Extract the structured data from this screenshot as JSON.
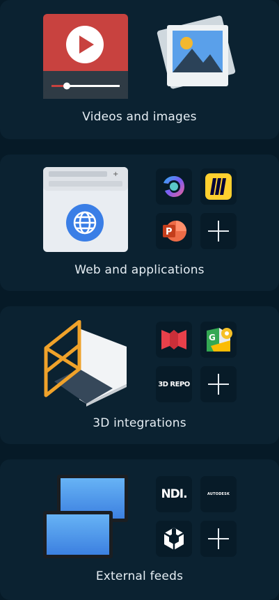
{
  "sections": [
    {
      "label": "Videos and images"
    },
    {
      "label": "Web and applications"
    },
    {
      "label": "3D integrations"
    },
    {
      "label": "External feeds"
    }
  ],
  "logos": {
    "threed_repo": "3D REPO",
    "ndi": "NDI.",
    "autodesk": "AUTODESK"
  },
  "colors": {
    "background": "#061a27",
    "card": "#0b2231",
    "tile": "#071b28",
    "video_red": "#c8423f",
    "accent_orange": "#f0a22a",
    "monitor_blue": "#4a93e8"
  }
}
